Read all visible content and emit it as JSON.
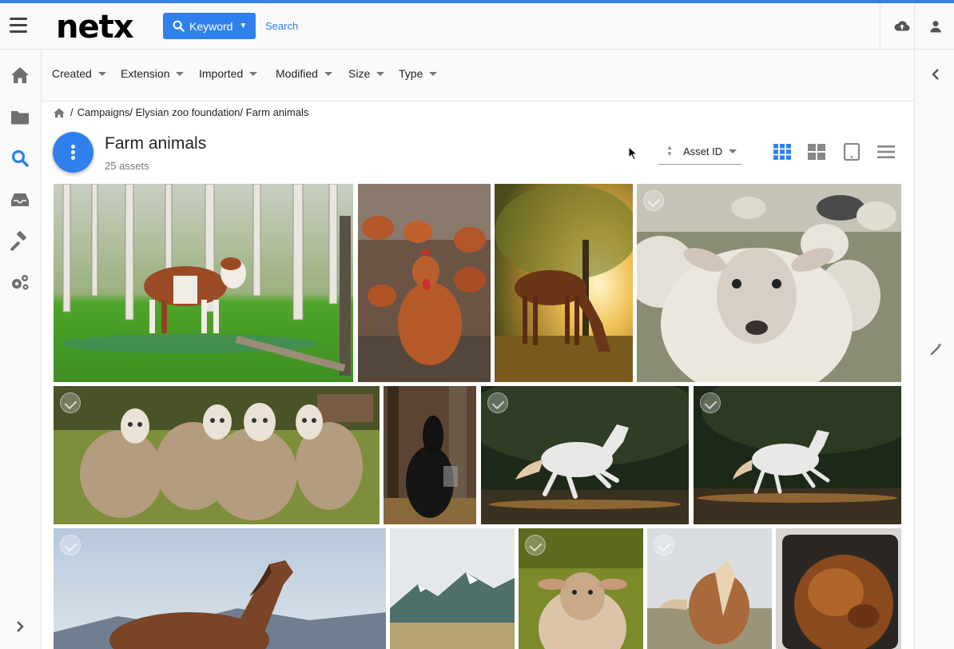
{
  "app": {
    "logo": "netx"
  },
  "header": {
    "search_mode_label": "Keyword",
    "search_link": "Search"
  },
  "filters": [
    {
      "label": "Created"
    },
    {
      "label": "Extension"
    },
    {
      "label": "Imported"
    },
    {
      "label": "Modified"
    },
    {
      "label": "Size"
    },
    {
      "label": "Type"
    }
  ],
  "breadcrumb": {
    "path": "Campaigns/ Elysian zoo foundation/ Farm animals"
  },
  "folder": {
    "title": "Farm animals",
    "count": "25 assets"
  },
  "sort": {
    "label": "Asset ID"
  },
  "colors": {
    "accent": "#2f80ed",
    "icon_gray": "#6f6f6f",
    "active_view": "#2f80ed"
  },
  "tiles": [
    {
      "name": "cow-in-forest",
      "subject": "brown and white cow in birch forest"
    },
    {
      "name": "chickens",
      "subject": "brown hens"
    },
    {
      "name": "horse-sunset",
      "subject": "horse grazing at sunset"
    },
    {
      "name": "sheep-closeup",
      "subject": "white sheep close-up"
    },
    {
      "name": "four-sheep",
      "subject": "four sheep in a field"
    },
    {
      "name": "black-horse",
      "subject": "black horse in woods"
    },
    {
      "name": "white-horse-1",
      "subject": "white horse galloping"
    },
    {
      "name": "white-horse-2",
      "subject": "white horse trotting"
    },
    {
      "name": "brown-horse",
      "subject": "brown horse under mountains"
    },
    {
      "name": "mountains",
      "subject": "snowy mountain valley"
    },
    {
      "name": "lamb",
      "subject": "sheep in grass"
    },
    {
      "name": "palomino-horse",
      "subject": "palomino horse"
    },
    {
      "name": "roast-turkey",
      "subject": "roast turkey"
    }
  ]
}
